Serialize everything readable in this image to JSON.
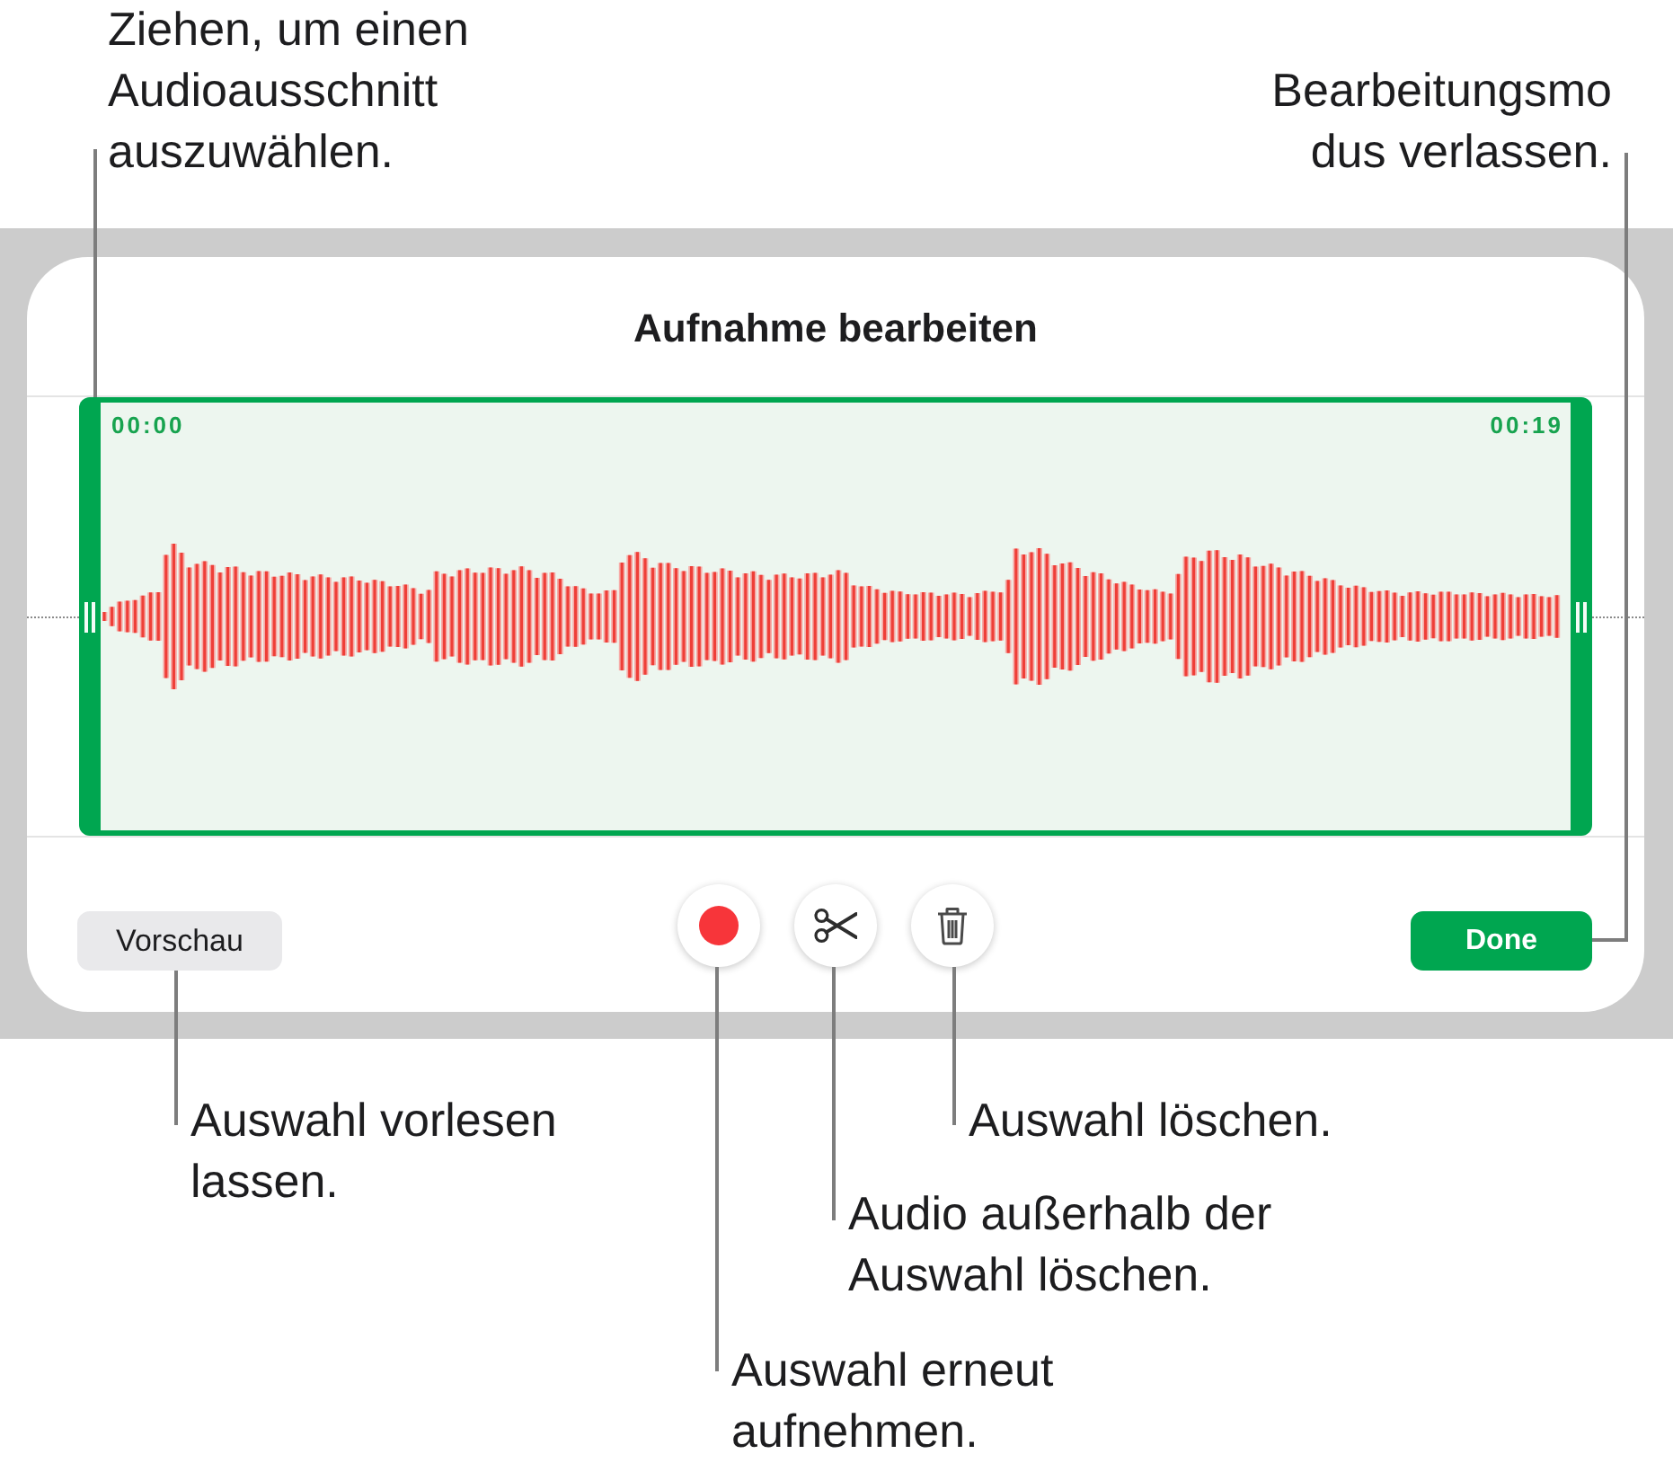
{
  "annotations_top": [
    {
      "kind": "handle",
      "lines": [
        "Ziehen, um einen",
        "Audioausschnitt",
        "auszuwählen."
      ]
    },
    {
      "kind": "done",
      "lines": [
        "Bearbeitungsmo",
        "dus verlassen."
      ]
    }
  ],
  "editor": {
    "title": "Aufnahme bearbeiten",
    "start_time": "00:00",
    "end_time": "00:19",
    "preview_button": "Vorschau",
    "tools": [
      {
        "kind": "record"
      },
      {
        "kind": "trim"
      },
      {
        "kind": "delete"
      }
    ],
    "done_button": "Done"
  },
  "annotations_bottom": [
    {
      "kind": "preview",
      "lines": [
        "Auswahl vorlesen",
        "lassen."
      ]
    },
    {
      "kind": "delete",
      "lines": [
        "Auswahl löschen."
      ]
    },
    {
      "kind": "trim",
      "lines": [
        "Audio außerhalb der",
        "Auswahl löschen."
      ]
    },
    {
      "kind": "record",
      "lines": [
        "Auswahl erneut",
        "aufnehmen."
      ]
    }
  ]
}
